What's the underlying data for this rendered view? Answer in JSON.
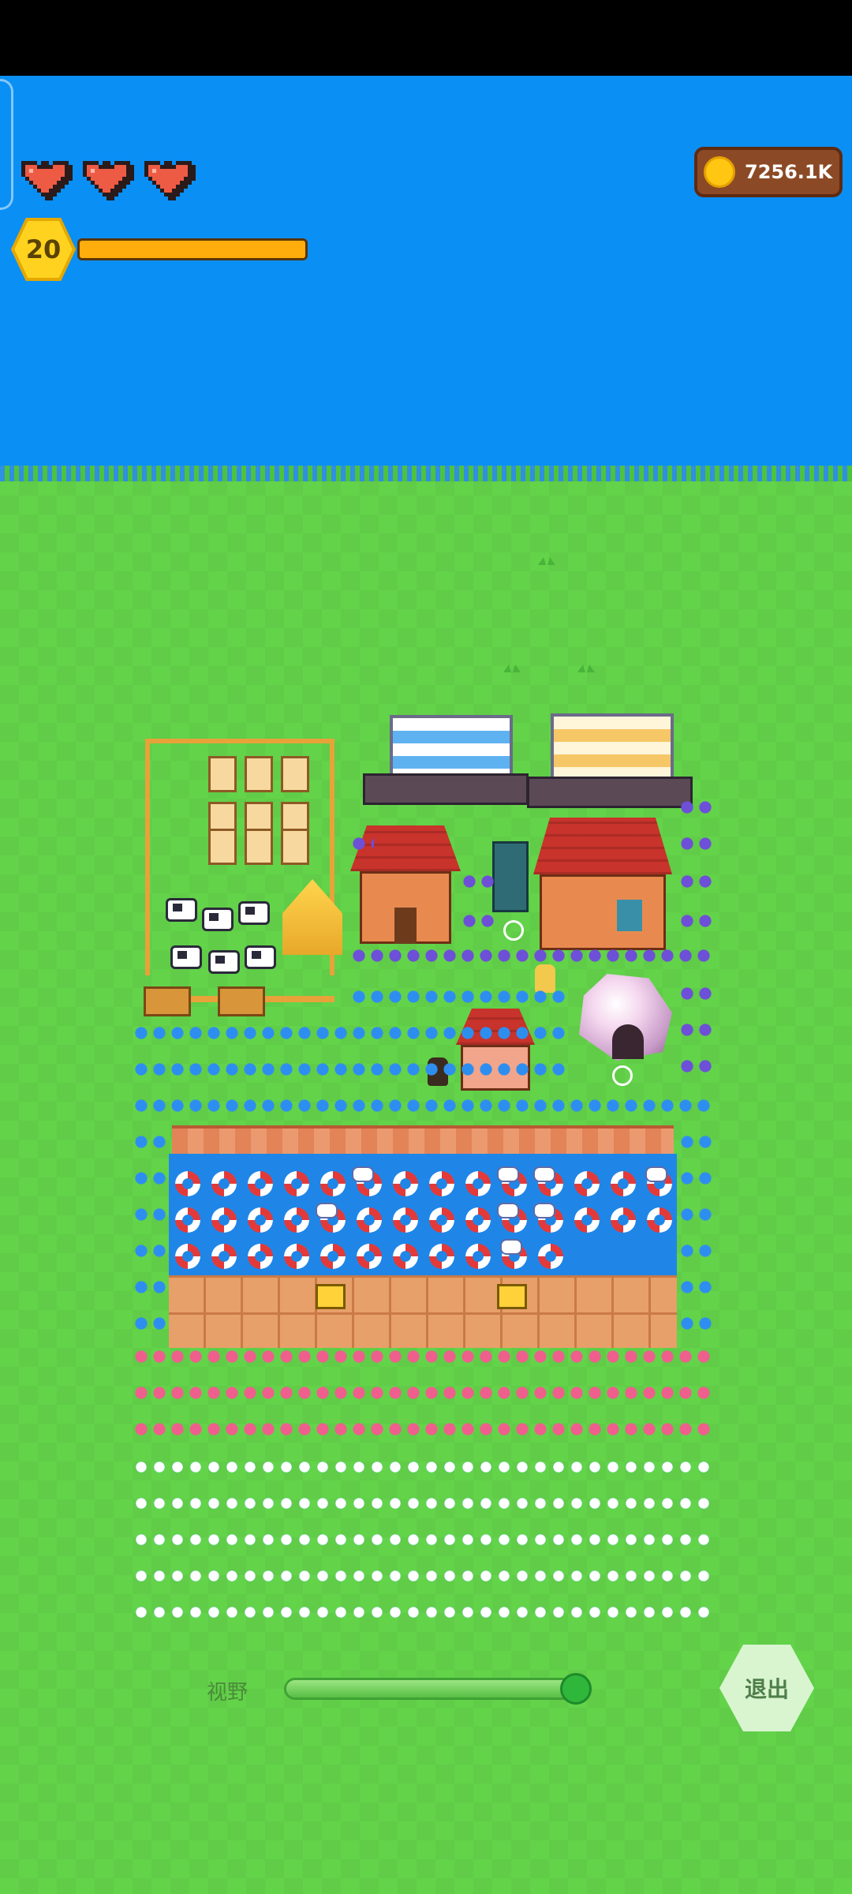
{
  "hud": {
    "hearts": 3,
    "level": "20",
    "xp_fraction": 1.0,
    "coins": "7256.1K",
    "icons": {
      "heart": "heart-icon",
      "coin": "coin-icon",
      "level": "hexagon-level-icon"
    }
  },
  "colors": {
    "sky": "#0a8ff5",
    "grass": "#63d34a",
    "xp_bar": "#ffad0d",
    "coin_panel": "#8b4a25"
  },
  "controls": {
    "view_label": "视野",
    "view_zoom_fraction": 0.98,
    "exit_label": "退出"
  }
}
